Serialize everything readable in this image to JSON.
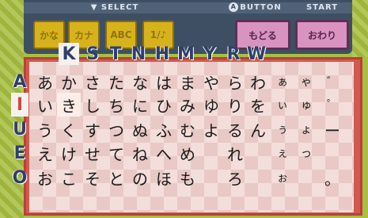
{
  "header": {
    "select_label": "▼ SELECT",
    "button_icon": "A",
    "button_label": "BUTTON",
    "start_label": "START"
  },
  "mode_buttons": [
    {
      "label": "かな"
    },
    {
      "label": "カナ"
    },
    {
      "label": "ABC"
    },
    {
      "label": "1/♪"
    }
  ],
  "action_buttons": {
    "back": "もどる",
    "done": "おわり"
  },
  "column_labels": [
    "K",
    "S",
    "T",
    "N",
    "H",
    "M",
    "Y",
    "R",
    "W"
  ],
  "row_labels": [
    "A",
    "I",
    "U",
    "E",
    "O"
  ],
  "grid": [
    [
      "あ",
      "か",
      "さ",
      "た",
      "な",
      "は",
      "ま",
      "や",
      "ら",
      "わ",
      "ぁ",
      "ゃ",
      "゛"
    ],
    [
      "い",
      "き",
      "し",
      "ち",
      "に",
      "ひ",
      "み",
      "ゆ",
      "り",
      "を",
      "ぃ",
      "ゅ",
      "゜"
    ],
    [
      "う",
      "く",
      "す",
      "つ",
      "ぬ",
      "ふ",
      "む",
      "よ",
      "る",
      "ん",
      "ぅ",
      "ょ",
      "ー"
    ],
    [
      "え",
      "け",
      "せ",
      "て",
      "ね",
      "へ",
      "め",
      "",
      "れ",
      "",
      "ぇ",
      "っ",
      ""
    ],
    [
      "お",
      "こ",
      "そ",
      "と",
      "の",
      "ほ",
      "も",
      "",
      "ろ",
      "",
      "ぉ",
      "",
      "。"
    ]
  ],
  "selected": {
    "row": "I",
    "column": "K",
    "char": "き"
  },
  "colors": {
    "background": "#a8bf45",
    "top_bar": "#3f4f63",
    "mode_button": "#d8b21c",
    "action_button": "#d993c1",
    "panel_border": "#d05a4e",
    "grid_bg": "#f4dedb",
    "label_color": "#2f3f6a"
  }
}
